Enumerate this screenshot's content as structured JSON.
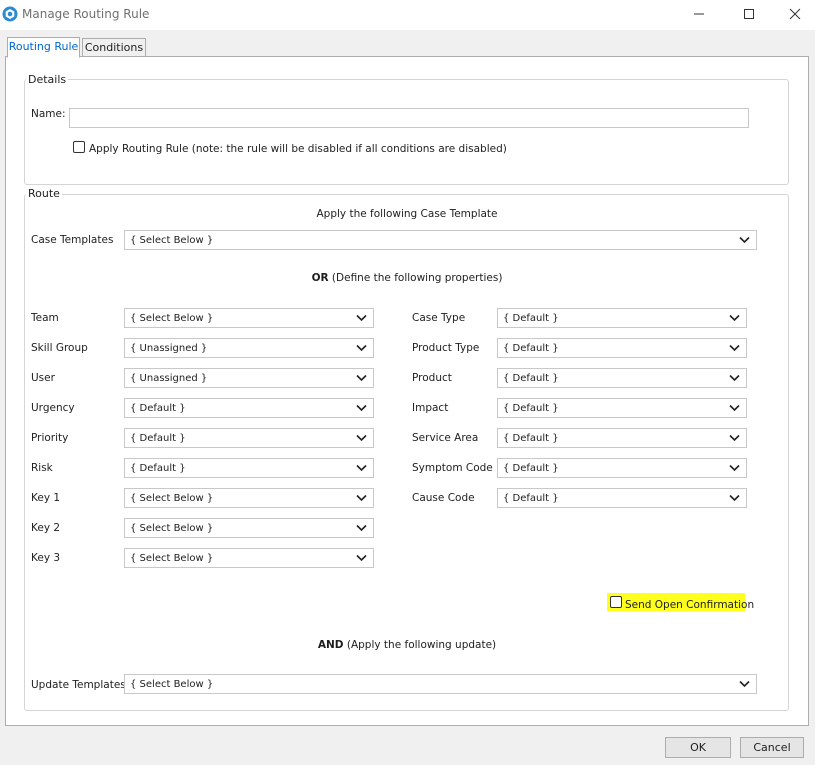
{
  "window": {
    "title": "Manage Routing Rule"
  },
  "tabs": [
    {
      "label": "Routing Rule",
      "active": true
    },
    {
      "label": "Conditions",
      "active": false
    }
  ],
  "details": {
    "legend": "Details",
    "name_label": "Name:",
    "name_value": "",
    "apply_label": "Apply Routing Rule (note: the rule will be disabled if all conditions are disabled)",
    "apply_checked": false
  },
  "route": {
    "legend": "Route",
    "case_template_heading": "Apply the following Case Template",
    "case_templates_label": "Case Templates",
    "case_templates_value": "{ Select Below }",
    "or_bold": "OR",
    "or_rest": "(Define the following properties)",
    "left_fields": [
      {
        "label": "Team",
        "value": "{ Select Below }"
      },
      {
        "label": "Skill Group",
        "value": "{ Unassigned }"
      },
      {
        "label": "User",
        "value": "{ Unassigned }"
      },
      {
        "label": "Urgency",
        "value": "{ Default }"
      },
      {
        "label": "Priority",
        "value": "{ Default }"
      },
      {
        "label": "Risk",
        "value": "{ Default }"
      },
      {
        "label": "Key 1",
        "value": "{ Select Below }"
      },
      {
        "label": "Key 2",
        "value": "{ Select Below }"
      },
      {
        "label": "Key 3",
        "value": "{ Select Below }"
      }
    ],
    "right_fields": [
      {
        "label": "Case Type",
        "value": "{ Default }"
      },
      {
        "label": "Product Type",
        "value": "{ Default }"
      },
      {
        "label": "Product",
        "value": "{ Default }"
      },
      {
        "label": "Impact",
        "value": "{ Default }"
      },
      {
        "label": "Service Area",
        "value": "{ Default }"
      },
      {
        "label": "Symptom Code",
        "value": "{ Default }"
      },
      {
        "label": "Cause Code",
        "value": "{ Default }"
      }
    ],
    "send_open_label": "Send Open Confirmation",
    "send_open_checked": false,
    "and_bold": "AND",
    "and_rest": "(Apply the following update)",
    "update_templates_label": "Update Templates",
    "update_templates_value": "{ Select Below }"
  },
  "buttons": {
    "ok": "OK",
    "cancel": "Cancel"
  },
  "colors": {
    "highlight": "#ffff1e",
    "active_tab_text": "#0066cc",
    "app_icon": "#2a8ad4"
  }
}
